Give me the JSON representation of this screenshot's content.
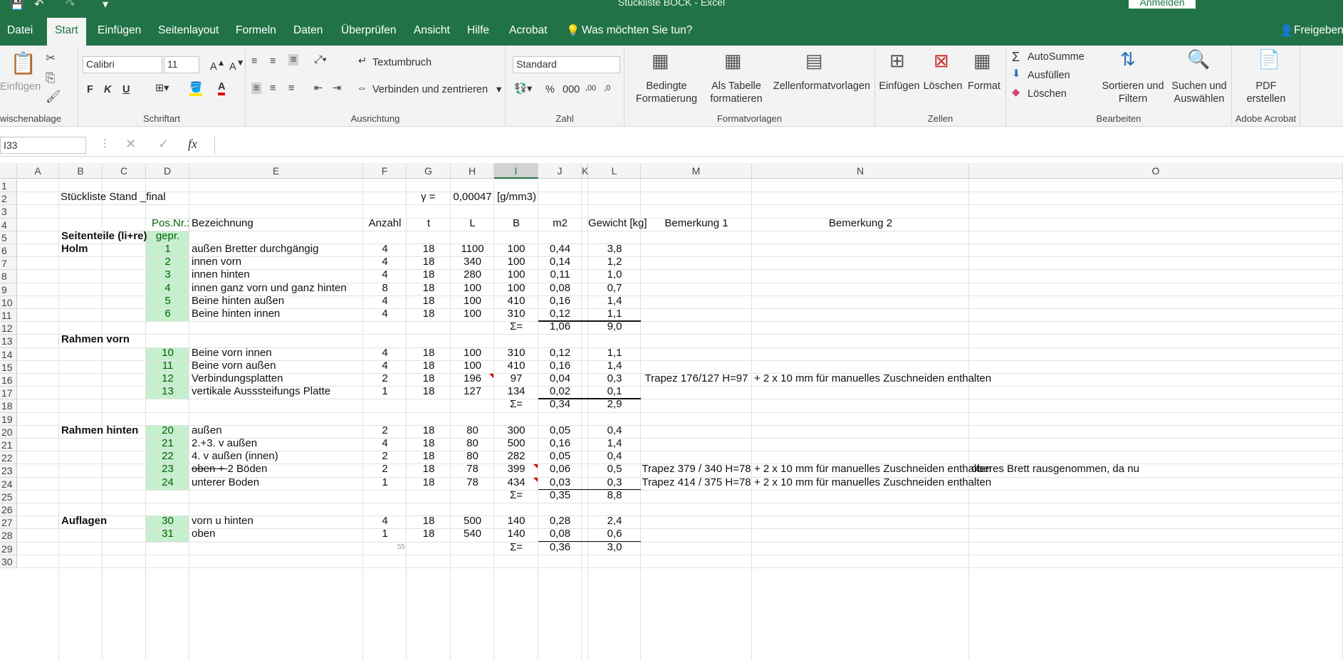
{
  "window": {
    "title": "Stückliste BOCK  -  Excel",
    "signin": "Anmelden"
  },
  "menu": {
    "tabs": [
      "Datei",
      "Start",
      "Einfügen",
      "Seitenlayout",
      "Formeln",
      "Daten",
      "Überprüfen",
      "Ansicht",
      "Hilfe",
      "Acrobat"
    ],
    "active": "Start",
    "tell_me": "Was möchten Sie tun?",
    "share": "Freigeben"
  },
  "ribbon": {
    "clipboard": {
      "paste": "Einfügen",
      "label": "wischenablage"
    },
    "font": {
      "name": "Calibri",
      "size": "11",
      "label": "Schriftart"
    },
    "alignment": {
      "wrap": "Textumbruch",
      "merge": "Verbinden und zentrieren",
      "label": "Ausrichtung"
    },
    "number": {
      "format": "Standard",
      "label": "Zahl"
    },
    "styles": {
      "cond1": "Bedingte",
      "cond2": "Formatierung",
      "table1": "Als Tabelle",
      "table2": "formatieren",
      "cell": "Zellenformatvorlagen",
      "label": "Formatvorlagen"
    },
    "cells": {
      "insert": "Einfügen",
      "delete": "Löschen",
      "format": "Format",
      "label": "Zellen"
    },
    "editing": {
      "autosum": "AutoSumme",
      "fill": "Ausfüllen",
      "clear": "Löschen",
      "sort1": "Sortieren und",
      "sort2": "Filtern",
      "find1": "Suchen und",
      "find2": "Auswählen",
      "label": "Bearbeiten"
    },
    "acrobat": {
      "pdf1": "PDF",
      "pdf2": "erstellen",
      "label": "Adobe Acrobat"
    }
  },
  "formula": {
    "namebox": "I33",
    "fx": "fx"
  },
  "columns": [
    "A",
    "B",
    "C",
    "D",
    "E",
    "F",
    "G",
    "H",
    "I",
    "J",
    "K",
    "L",
    "M",
    "N",
    "O"
  ],
  "selected_column": "I",
  "rows": [
    "1",
    "2",
    "3",
    "4",
    "5",
    "6",
    "7",
    "8",
    "9",
    "10",
    "11",
    "12",
    "13",
    "14",
    "15",
    "16",
    "17",
    "18",
    "19",
    "20",
    "21",
    "22",
    "23",
    "24",
    "25",
    "26",
    "27",
    "28",
    "29",
    "30"
  ],
  "cells": {
    "r2": {
      "b": "Stückliste Stand _final",
      "g": "γ =",
      "h": "0,00047",
      "i": "[g/mm3)"
    },
    "r4": {
      "d": "Pos.Nr.:",
      "e": "Bezeichnung",
      "f": "Anzahl",
      "g": "t",
      "h": "L",
      "i": "B",
      "j": "m2",
      "l": "Gewicht [kg]",
      "m": "Bemerkung 1",
      "n": "Bemerkung 2"
    },
    "r5": {
      "b": "Seitenteile (li+re)",
      "d": "gepr."
    },
    "r6": {
      "b": "Holm",
      "d": "1",
      "e": "außen Bretter durchgängig",
      "f": "4",
      "g": "18",
      "h": "1100",
      "i": "100",
      "j": "0,44",
      "l": "3,8"
    },
    "r7": {
      "d": "2",
      "e": "innen vorn",
      "f": "4",
      "g": "18",
      "h": "340",
      "i": "100",
      "j": "0,14",
      "l": "1,2"
    },
    "r8": {
      "d": "3",
      "e": "innen hinten",
      "f": "4",
      "g": "18",
      "h": "280",
      "i": "100",
      "j": "0,11",
      "l": "1,0"
    },
    "r9": {
      "d": "4",
      "e": "innen ganz vorn und ganz hinten",
      "f": "8",
      "g": "18",
      "h": "100",
      "i": "100",
      "j": "0,08",
      "l": "0,7"
    },
    "r10": {
      "d": "5",
      "e": "Beine hinten außen",
      "f": "4",
      "g": "18",
      "h": "100",
      "i": "410",
      "j": "0,16",
      "l": "1,4"
    },
    "r11": {
      "d": "6",
      "e": "Beine hinten innen",
      "f": "4",
      "g": "18",
      "h": "100",
      "i": "310",
      "j": "0,12",
      "l": "1,1"
    },
    "r12": {
      "i": "Σ=",
      "j": "1,06",
      "l": "9,0"
    },
    "r13": {
      "b": "Rahmen vorn"
    },
    "r14": {
      "d": "10",
      "e": "Beine vorn innen",
      "f": "4",
      "g": "18",
      "h": "100",
      "i": "310",
      "j": "0,12",
      "l": "1,1"
    },
    "r15": {
      "d": "11",
      "e": "Beine vorn außen",
      "f": "4",
      "g": "18",
      "h": "100",
      "i": "410",
      "j": "0,16",
      "l": "1,4"
    },
    "r16": {
      "d": "12",
      "e": "Verbindungsplatten",
      "f": "2",
      "g": "18",
      "h": "196",
      "i": "97",
      "j": "0,04",
      "l": "0,3",
      "m": "Trapez 176/127 H=97",
      "n": "+ 2 x 10 mm für manuelles Zuschneiden enthalten"
    },
    "r17": {
      "d": "13",
      "e": "vertikale Ausssteifungs Platte",
      "f": "1",
      "g": "18",
      "h": "127",
      "i": "134",
      "j": "0,02",
      "l": "0,1"
    },
    "r18": {
      "i": "Σ=",
      "j": "0,34",
      "l": "2,9"
    },
    "r20": {
      "b": "Rahmen hinten",
      "d": "20",
      "e": "außen",
      "f": "2",
      "g": "18",
      "h": "80",
      "i": "300",
      "j": "0,05",
      "l": "0,4"
    },
    "r21": {
      "d": "21",
      "e": "2.+3. v außen",
      "f": "4",
      "g": "18",
      "h": "80",
      "i": "500",
      "j": "0,16",
      "l": "1,4"
    },
    "r22": {
      "d": "22",
      "e": "4. v außen (innen)",
      "f": "2",
      "g": "18",
      "h": "80",
      "i": "282",
      "j": "0,05",
      "l": "0,4"
    },
    "r23": {
      "d": "23",
      "e_strike": "oben + ",
      "e": "2 Böden",
      "f": "2",
      "g": "18",
      "h": "78",
      "i": "399",
      "j": "0,06",
      "l": "0,5",
      "m": "Trapez 379 / 340 H=78",
      "n": "+ 2 x 10 mm für manuelles Zuschneiden enthalten",
      "o": "oberes Brett rausgenommen, da nu"
    },
    "r24": {
      "d": "24",
      "e": "unterer Boden",
      "f": "1",
      "g": "18",
      "h": "78",
      "i": "434",
      "j": "0,03",
      "l": "0,3",
      "m": "Trapez 414 / 375 H=78",
      "n": "+ 2 x 10 mm für manuelles Zuschneiden enthalten"
    },
    "r25": {
      "i": "Σ=",
      "j": "0,35",
      "l": "8,8"
    },
    "r27": {
      "b": "Auflagen",
      "d": "30",
      "e": "vorn u hinten",
      "f": "4",
      "g": "18",
      "h": "500",
      "i": "140",
      "j": "0,28",
      "l": "2,4"
    },
    "r28": {
      "d": "31",
      "e": "oben",
      "f": "1",
      "g": "18",
      "h": "540",
      "i": "140",
      "j": "0,08",
      "l": "0,6"
    },
    "r29": {
      "f_small": "55",
      "i": "Σ=",
      "j": "0,36",
      "l": "3,0"
    }
  },
  "colors": {
    "brand": "#217346",
    "green_fill": "#c6efce",
    "green_text": "#006100",
    "comment": "#d00000"
  }
}
